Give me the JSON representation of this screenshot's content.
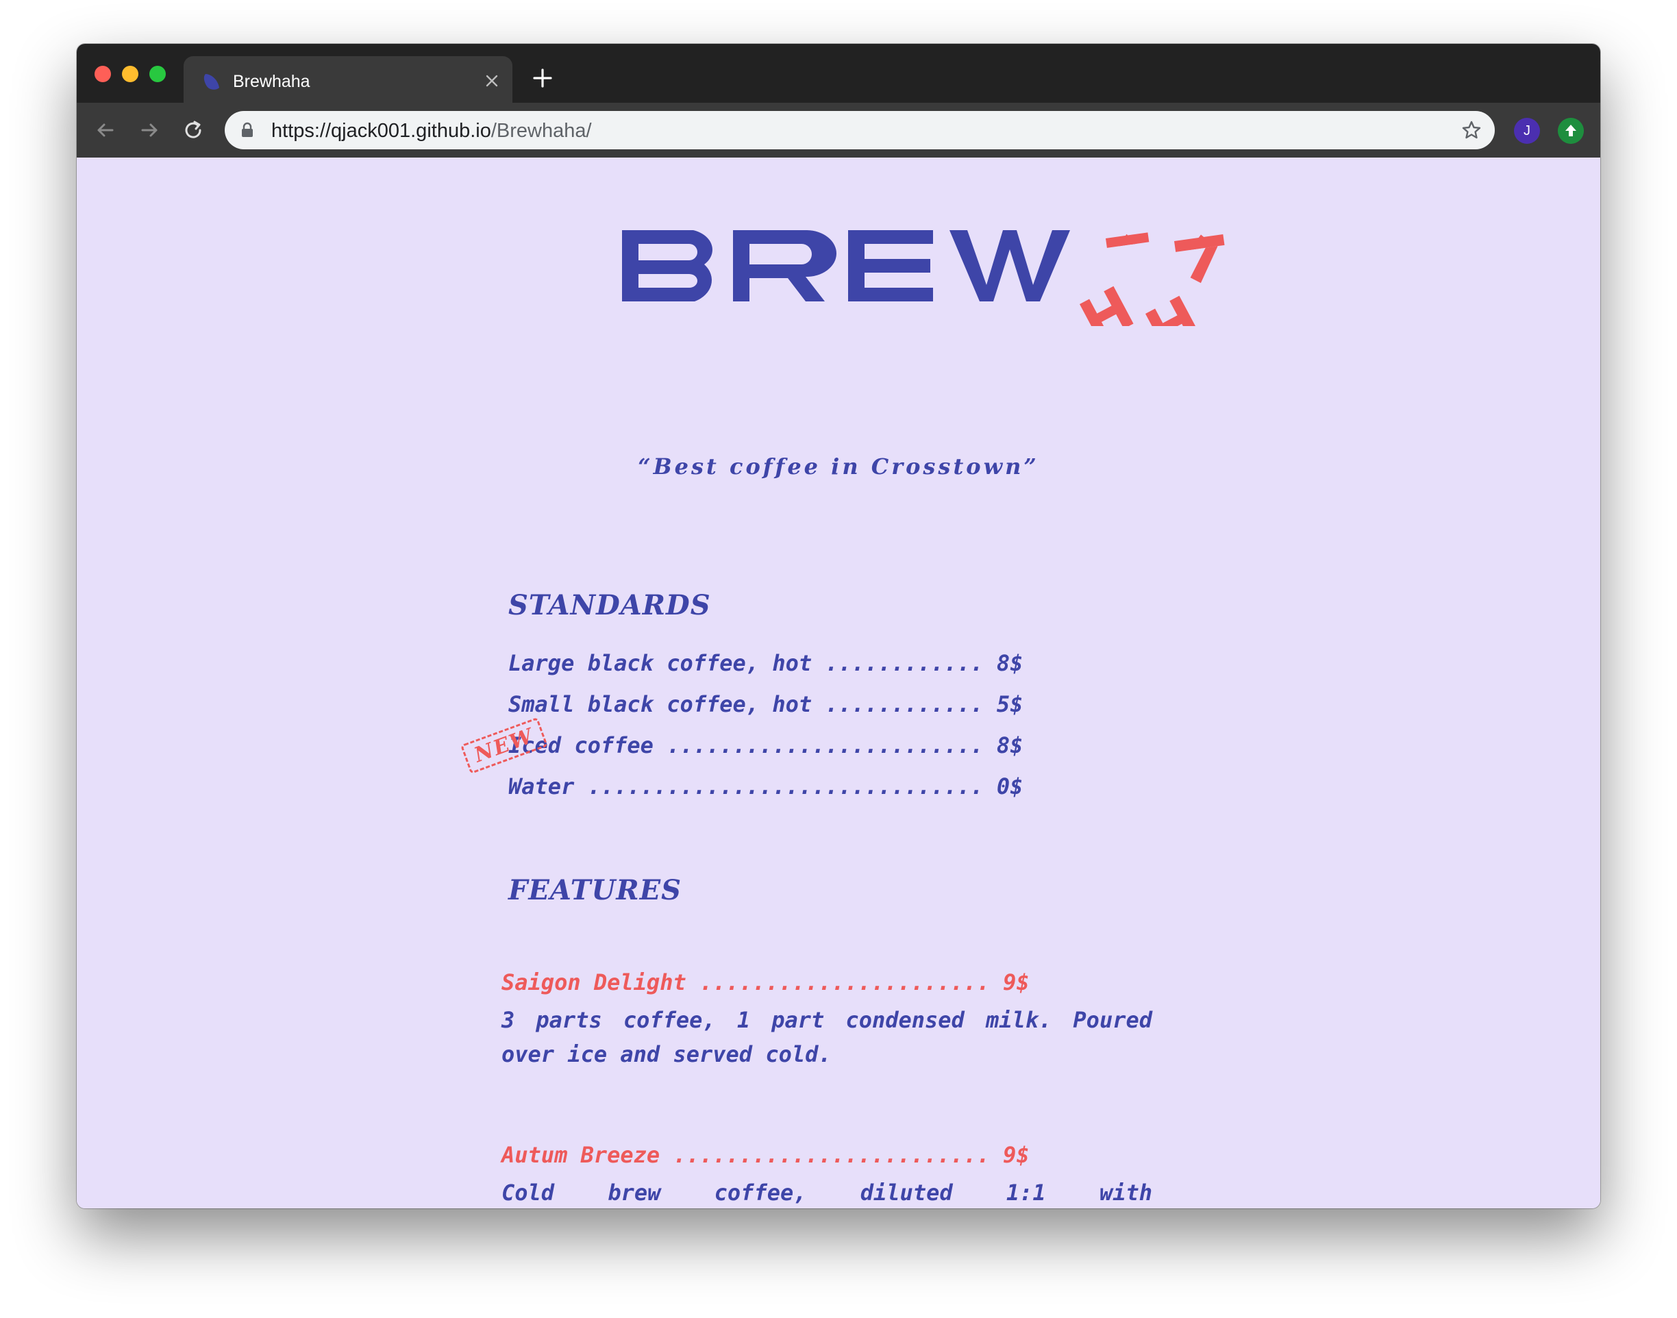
{
  "browser": {
    "tab_title": "Brewhaha",
    "url_host": "https://qjack001.github.io",
    "url_path": "/Brewhaha/",
    "profile_initial": "J"
  },
  "logo": {
    "main": "BREW",
    "accent": "HAHA"
  },
  "tagline": "“Best coffee in Crosstown”",
  "standards": {
    "title": "STANDARDS",
    "items": [
      {
        "name": "Large black coffee, hot",
        "dots": " ............ ",
        "price": "8$"
      },
      {
        "name": "Small black coffee, hot",
        "dots": " ............ ",
        "price": "5$"
      },
      {
        "name": "Iced coffee",
        "dots": " ........................ ",
        "price": "8$",
        "badge": "NEW"
      },
      {
        "name": "Water",
        "dots": " .............................. ",
        "price": "0$"
      }
    ]
  },
  "features": {
    "title": "FEATURES",
    "items": [
      {
        "name": "Saigon Delight",
        "dots": " ...................... ",
        "price": "9$",
        "description": "3 parts coffee, 1 part condensed milk. Poured over ice and served cold."
      },
      {
        "name": "Autum Breeze",
        "dots": " ........................ ",
        "price": "9$",
        "description": "Cold brew coffee, diluted 1:1 with"
      }
    ]
  },
  "colors": {
    "primary": "#3e45a8",
    "accent": "#ee5a5a",
    "background": "#e7dffa"
  }
}
